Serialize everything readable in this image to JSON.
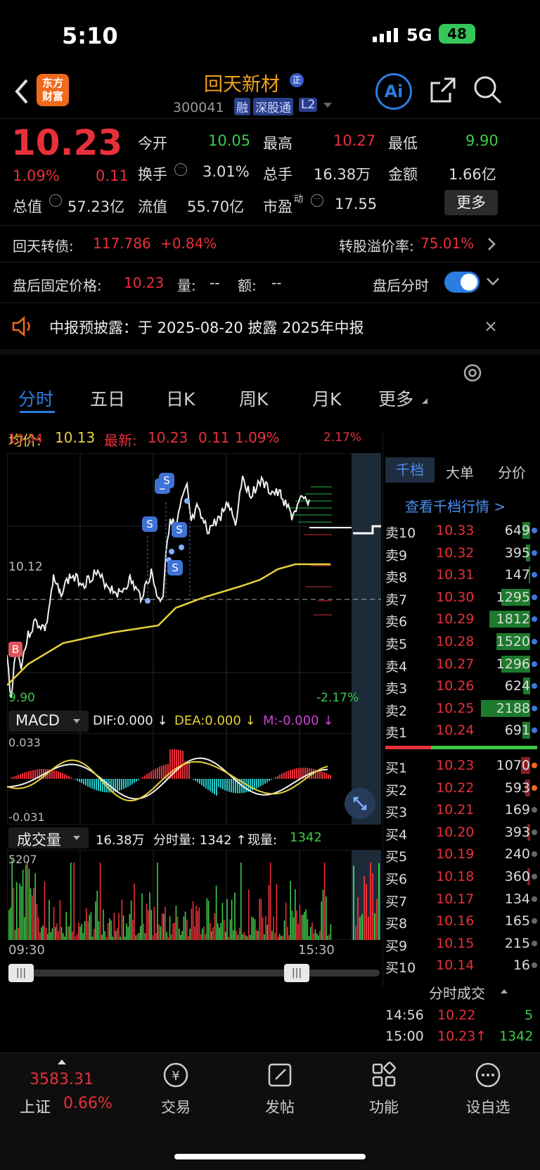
{
  "status": {
    "time": "5:10",
    "network": "5G",
    "battery": "48"
  },
  "header": {
    "logo_line1": "东方",
    "logo_line2": "财富",
    "name": "回天新材",
    "name_badge": "正",
    "code": "300041",
    "tag_rong": "融",
    "tag_sgt": "深股通",
    "tag_l2": "L2",
    "ai_label": "Ai"
  },
  "quote": {
    "price": "10.23",
    "pct": "1.09%",
    "chg": "0.11",
    "open_label": "今开",
    "open": "10.05",
    "high_label": "最高",
    "high": "10.27",
    "low_label": "最低",
    "low": "9.90",
    "turnover_label": "换手",
    "turnover": "3.01%",
    "vol_label": "总手",
    "vol": "16.38万",
    "amt_label": "金额",
    "amt": "1.66亿",
    "mktcap_label": "总值",
    "mktcap": "57.23亿",
    "float_label": "流值",
    "float": "55.70亿",
    "pe_label": "市盈",
    "pe_sup": "动",
    "pe": "17.55",
    "more": "更多"
  },
  "bond": {
    "label": "回天转债:",
    "price": "117.786",
    "pct": "+0.84%",
    "premium_label": "转股溢价率:",
    "premium": "75.01%"
  },
  "after": {
    "label": "盘后固定价格:",
    "price": "10.23",
    "vol_label": "量:",
    "vol": "--",
    "amt_label": "额:",
    "amt": "--",
    "toggle_label": "盘后分时"
  },
  "notice": {
    "text": "中报预披露：于 2025-08-20 披露 2025年中报"
  },
  "tabs": [
    "分时",
    "五日",
    "日K",
    "周K",
    "月K",
    "更多"
  ],
  "chart_info": {
    "avg_label": "均价:",
    "avg": "10.13",
    "latest_label": "最新:",
    "latest": "10.23",
    "chg": "0.11",
    "pct": "1.09%"
  },
  "chart_axis": {
    "top": "10.34",
    "mid": "10.12",
    "bottom": "9.90",
    "top_pct": "2.17%",
    "bottom_pct": "-2.17%",
    "start_time": "09:30",
    "end_time": "15:30"
  },
  "macd": {
    "label": "MACD",
    "dif": "DIF:0.000 ↓",
    "dea": "DEA:0.000 ↓",
    "m": "M:-0.000 ↓",
    "top": "0.033",
    "bottom": "-0.031"
  },
  "volume": {
    "label": "成交量",
    "total": "16.38万",
    "min_vol": "分时量: 1342 ↑",
    "cur_label": "现量:",
    "cur": "1342",
    "max": "5207"
  },
  "side_tabs": [
    "千档",
    "大单",
    "分价"
  ],
  "side_link": "查看千档行情 >",
  "asks": [
    {
      "label": "卖10",
      "price": "10.33",
      "vol": "649",
      "bar": 0.15
    },
    {
      "label": "卖9",
      "price": "10.32",
      "vol": "395",
      "bar": 0.09
    },
    {
      "label": "卖8",
      "price": "10.31",
      "vol": "147",
      "bar": 0.03
    },
    {
      "label": "卖7",
      "price": "10.30",
      "vol": "1295",
      "bar": 0.59
    },
    {
      "label": "卖6",
      "price": "10.29",
      "vol": "1812",
      "bar": 0.83
    },
    {
      "label": "卖5",
      "price": "10.28",
      "vol": "1520",
      "bar": 0.69
    },
    {
      "label": "卖4",
      "price": "10.27",
      "vol": "1296",
      "bar": 0.59
    },
    {
      "label": "卖3",
      "price": "10.26",
      "vol": "624",
      "bar": 0.14
    },
    {
      "label": "卖2",
      "price": "10.25",
      "vol": "2188",
      "bar": 1.0
    },
    {
      "label": "卖1",
      "price": "10.24",
      "vol": "691",
      "bar": 0.16
    }
  ],
  "bids": [
    {
      "label": "买1",
      "price": "10.23",
      "vol": "1070",
      "bar": 0.18
    },
    {
      "label": "买2",
      "price": "10.22",
      "vol": "593",
      "bar": 0.1
    },
    {
      "label": "买3",
      "price": "10.21",
      "vol": "169",
      "bar": 0
    },
    {
      "label": "买4",
      "price": "10.20",
      "vol": "393",
      "bar": 0.05
    },
    {
      "label": "买5",
      "price": "10.19",
      "vol": "240",
      "bar": 0
    },
    {
      "label": "买6",
      "price": "10.18",
      "vol": "360",
      "bar": 0.05
    },
    {
      "label": "买7",
      "price": "10.17",
      "vol": "134",
      "bar": 0
    },
    {
      "label": "买8",
      "price": "10.16",
      "vol": "165",
      "bar": 0
    },
    {
      "label": "买9",
      "price": "10.15",
      "vol": "215",
      "bar": 0
    },
    {
      "label": "买10",
      "price": "10.14",
      "vol": "16",
      "bar": 0
    }
  ],
  "ticks_header": "分时成交",
  "ticks": [
    {
      "time": "14:56",
      "price": "10.22",
      "vol": "5"
    },
    {
      "time": "15:00",
      "price": "10.23↑",
      "vol": "1342"
    }
  ],
  "index": {
    "value": "3583.31",
    "name": "上证",
    "pct": "0.66%"
  },
  "nav": [
    "交易",
    "发帖",
    "功能",
    "设自选"
  ],
  "colors": {
    "up": "#e8303a",
    "down": "#3ec94a",
    "avg": "#e6d23c",
    "accent": "#2a7de1"
  }
}
